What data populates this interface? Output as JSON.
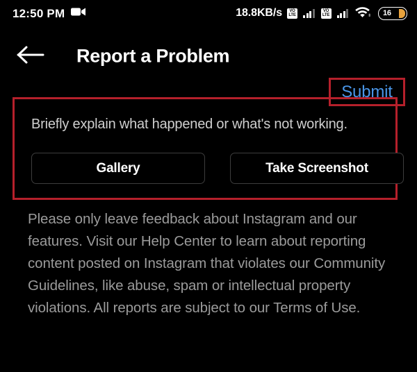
{
  "status_bar": {
    "time": "12:50 PM",
    "recording_icon": "videocam-icon",
    "network_speed": "18.8KB/s",
    "sim1_badge_top": "VO",
    "sim1_badge_bottom": "LTE",
    "sim2_badge_top": "VO",
    "sim2_badge_bottom": "LTE",
    "wifi_icon": "wifi-icon",
    "battery_level": "16",
    "battery_accent_color": "#e8a33d"
  },
  "header": {
    "back_icon": "arrow-left-icon",
    "title": "Report a Problem",
    "submit_label": "Submit",
    "submit_color": "#4a96e8",
    "annotation_color": "#b5202b"
  },
  "report_form": {
    "placeholder": "Briefly explain what happened or what's not working.",
    "buttons": [
      {
        "label": "Gallery",
        "name": "gallery-button"
      },
      {
        "label": "Take Screenshot",
        "name": "take-screenshot-button"
      }
    ]
  },
  "disclaimer": {
    "text": "Please only leave feedback about Instagram and our features. Visit our Help Center to learn about reporting content posted on Instagram that violates our Community Guidelines, like abuse, spam or intellectual property violations. All reports are subject to our Terms of Use."
  }
}
